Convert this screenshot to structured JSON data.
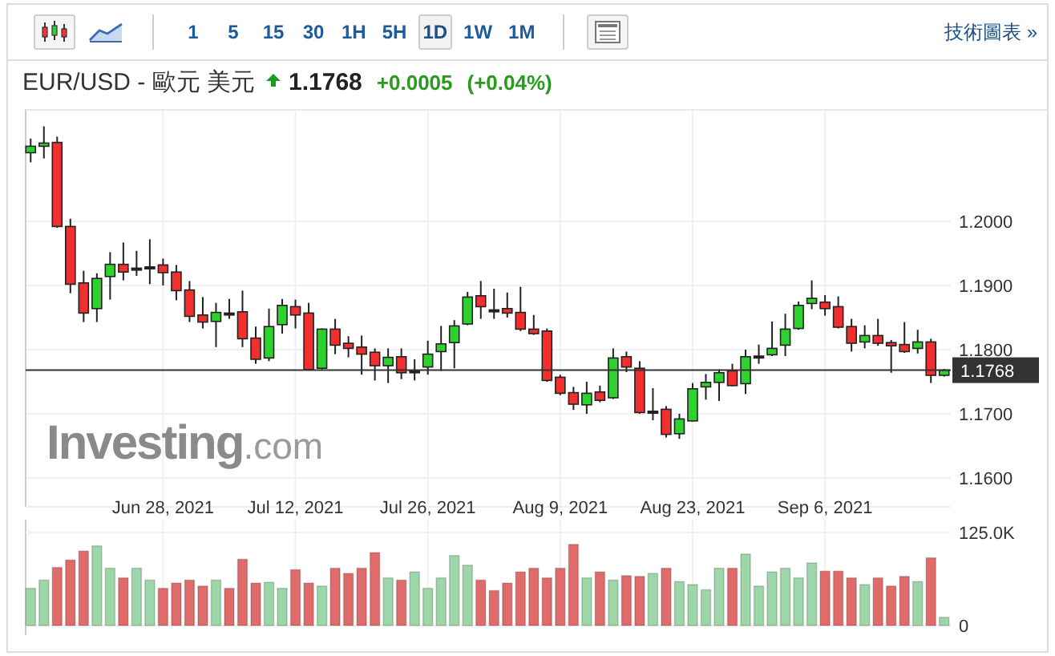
{
  "toolbar": {
    "chart_types": [
      {
        "kind": "candlestick",
        "selected": true
      },
      {
        "kind": "line",
        "selected": false
      }
    ],
    "intervals": [
      {
        "label": "1",
        "selected": false
      },
      {
        "label": "5",
        "selected": false
      },
      {
        "label": "15",
        "selected": false
      },
      {
        "label": "30",
        "selected": false
      },
      {
        "label": "1H",
        "selected": false
      },
      {
        "label": "5H",
        "selected": false
      },
      {
        "label": "1D",
        "selected": true
      },
      {
        "label": "1W",
        "selected": false
      },
      {
        "label": "1M",
        "selected": false
      }
    ],
    "link": "技術圖表 »"
  },
  "header": {
    "symbol": "EUR/USD - 歐元 美元",
    "price": "1.1768",
    "change": "+0.0005",
    "change_percent": "(+0.04%)"
  },
  "logo": {
    "name": "Investing",
    "domain": ".com"
  },
  "chart": {
    "chart_data": {
      "type": "candlestick",
      "grid": true,
      "categories": [
        null,
        null,
        null,
        null,
        null,
        null,
        null,
        null,
        null,
        null,
        "Jun 28, 2021",
        null,
        null,
        null,
        null,
        null,
        null,
        null,
        null,
        null,
        "Jul 12, 2021",
        null,
        null,
        null,
        null,
        null,
        null,
        null,
        null,
        null,
        "Jul 26, 2021",
        null,
        null,
        null,
        null,
        null,
        null,
        null,
        null,
        null,
        "Aug 9, 2021",
        null,
        null,
        null,
        null,
        null,
        null,
        null,
        null,
        null,
        "Aug 23, 2021",
        null,
        null,
        null,
        null,
        null,
        null,
        null,
        null,
        null,
        "Sep 6, 2021",
        null,
        null,
        null,
        null,
        null,
        null,
        null,
        null,
        null
      ],
      "ylim": [
        1.1555,
        1.2175
      ],
      "yticks": [
        {
          "value": 1.16,
          "label": "1.1600"
        },
        {
          "value": 1.17,
          "label": "1.1700"
        },
        {
          "value": 1.18,
          "label": "1.1800"
        },
        {
          "value": 1.19,
          "label": "1.1900"
        },
        {
          "value": 1.2,
          "label": "1.2000"
        }
      ],
      "ref_lines": [
        {
          "axis": "y",
          "value": 1.1768,
          "label": "1.1768"
        }
      ],
      "ohlc": [
        [
          1.2107,
          1.2129,
          1.2092,
          1.2117
        ],
        [
          1.2117,
          1.2148,
          1.2098,
          1.2122
        ],
        [
          1.2123,
          1.2132,
          1.199,
          1.1992
        ],
        [
          1.1992,
          1.2004,
          1.1888,
          1.1902
        ],
        [
          1.1904,
          1.1923,
          1.1843,
          1.1857
        ],
        [
          1.1864,
          1.1919,
          1.1843,
          1.1911
        ],
        [
          1.1914,
          1.1952,
          1.1878,
          1.1933
        ],
        [
          1.1933,
          1.1967,
          1.1908,
          1.1921
        ],
        [
          1.1927,
          1.1954,
          1.1915,
          1.1925
        ],
        [
          1.1929,
          1.1972,
          1.1902,
          1.1927
        ],
        [
          1.1932,
          1.1942,
          1.19,
          1.192
        ],
        [
          1.1921,
          1.1932,
          1.1877,
          1.1892
        ],
        [
          1.1893,
          1.1907,
          1.1843,
          1.1852
        ],
        [
          1.1854,
          1.1882,
          1.1833,
          1.1843
        ],
        [
          1.1844,
          1.1873,
          1.1804,
          1.1858
        ],
        [
          1.1857,
          1.1879,
          1.1848,
          1.1856
        ],
        [
          1.1859,
          1.1892,
          1.1804,
          1.1817
        ],
        [
          1.1818,
          1.1836,
          1.1778,
          1.1785
        ],
        [
          1.1787,
          1.1864,
          1.1782,
          1.1836
        ],
        [
          1.1839,
          1.1879,
          1.1825,
          1.1869
        ],
        [
          1.1867,
          1.1878,
          1.1833,
          1.1854
        ],
        [
          1.1857,
          1.1873,
          1.1769,
          1.1769
        ],
        [
          1.1771,
          1.1833,
          1.1769,
          1.1832
        ],
        [
          1.1832,
          1.1848,
          1.1793,
          1.1807
        ],
        [
          1.181,
          1.1821,
          1.1788,
          1.1802
        ],
        [
          1.1804,
          1.1822,
          1.1761,
          1.1793
        ],
        [
          1.1796,
          1.1802,
          1.1752,
          1.1775
        ],
        [
          1.1775,
          1.1802,
          1.1748,
          1.1788
        ],
        [
          1.1789,
          1.1802,
          1.1754,
          1.1764
        ],
        [
          1.1767,
          1.1785,
          1.1752,
          1.1765
        ],
        [
          1.1773,
          1.1814,
          1.1761,
          1.1793
        ],
        [
          1.1797,
          1.1837,
          1.1767,
          1.1809
        ],
        [
          1.1811,
          1.1846,
          1.1771,
          1.1837
        ],
        [
          1.184,
          1.189,
          1.1838,
          1.1882
        ],
        [
          1.1884,
          1.1907,
          1.1848,
          1.1867
        ],
        [
          1.1862,
          1.1895,
          1.1848,
          1.186
        ],
        [
          1.1864,
          1.1889,
          1.185,
          1.1857
        ],
        [
          1.1858,
          1.1898,
          1.1829,
          1.1832
        ],
        [
          1.1832,
          1.1854,
          1.1823,
          1.1825
        ],
        [
          1.1829,
          1.1833,
          1.175,
          1.1752
        ],
        [
          1.1757,
          1.1761,
          1.1729,
          1.1732
        ],
        [
          1.1733,
          1.1742,
          1.1706,
          1.1715
        ],
        [
          1.1714,
          1.175,
          1.17,
          1.1732
        ],
        [
          1.1734,
          1.1744,
          1.1718,
          1.1721
        ],
        [
          1.1725,
          1.1802,
          1.1723,
          1.1787
        ],
        [
          1.1789,
          1.1797,
          1.1765,
          1.1773
        ],
        [
          1.1771,
          1.1782,
          1.17,
          1.1702
        ],
        [
          1.1704,
          1.174,
          1.169,
          1.1702
        ],
        [
          1.1707,
          1.1712,
          1.1663,
          1.1668
        ],
        [
          1.1669,
          1.17,
          1.1661,
          1.1692
        ],
        [
          1.1689,
          1.1748,
          1.1688,
          1.1739
        ],
        [
          1.1742,
          1.1762,
          1.1722,
          1.1749
        ],
        [
          1.1749,
          1.1769,
          1.172,
          1.1764
        ],
        [
          1.1767,
          1.1778,
          1.1743,
          1.1744
        ],
        [
          1.1747,
          1.18,
          1.1731,
          1.1789
        ],
        [
          1.179,
          1.1808,
          1.1778,
          1.1788
        ],
        [
          1.1792,
          1.1844,
          1.179,
          1.1802
        ],
        [
          1.1807,
          1.1856,
          1.179,
          1.1832
        ],
        [
          1.1833,
          1.1875,
          1.1831,
          1.1869
        ],
        [
          1.1872,
          1.1908,
          1.1863,
          1.188
        ],
        [
          1.1874,
          1.1885,
          1.1853,
          1.1864
        ],
        [
          1.1867,
          1.1883,
          1.1833,
          1.1835
        ],
        [
          1.1836,
          1.1848,
          1.1797,
          1.181
        ],
        [
          1.1812,
          1.1838,
          1.1802,
          1.1822
        ],
        [
          1.1822,
          1.1848,
          1.1806,
          1.181
        ],
        [
          1.1811,
          1.1815,
          1.1764,
          1.1806
        ],
        [
          1.1808,
          1.1843,
          1.1795,
          1.1797
        ],
        [
          1.1802,
          1.1831,
          1.1794,
          1.1812
        ],
        [
          1.1812,
          1.1817,
          1.1748,
          1.176
        ],
        [
          1.176,
          1.177,
          1.1758,
          1.1768
        ]
      ]
    }
  },
  "volume": {
    "chart_data": {
      "type": "bar",
      "stacked": true,
      "grid": true,
      "ylim": [
        0,
        125
      ],
      "yticks": [
        {
          "value": 0,
          "label": "0"
        },
        {
          "value": 125,
          "label": "125.0K"
        }
      ],
      "series": [
        {
          "color": "#9dd6a8",
          "values": [
            50,
            61,
            null,
            null,
            null,
            107,
            77,
            null,
            77,
            61,
            null,
            null,
            null,
            null,
            61,
            null,
            null,
            null,
            58,
            50,
            null,
            null,
            53,
            null,
            null,
            null,
            null,
            64,
            null,
            72,
            50,
            64,
            94,
            81,
            null,
            null,
            null,
            null,
            null,
            null,
            null,
            null,
            64,
            null,
            61,
            null,
            null,
            70,
            null,
            59,
            55,
            48,
            77,
            null,
            96,
            53,
            72,
            77,
            64,
            84,
            null,
            null,
            null,
            55,
            null,
            null,
            null,
            59,
            null,
            11
          ]
        },
        {
          "color": "#e06b6b",
          "values": [
            null,
            null,
            78,
            88,
            100,
            null,
            null,
            64,
            null,
            null,
            50,
            57,
            61,
            53,
            null,
            50,
            89,
            57,
            null,
            null,
            75,
            57,
            null,
            77,
            70,
            77,
            98,
            null,
            61,
            null,
            null,
            null,
            null,
            null,
            61,
            47,
            57,
            72,
            77,
            64,
            77,
            109,
            null,
            72,
            null,
            67,
            66,
            null,
            77,
            null,
            null,
            null,
            null,
            77,
            null,
            null,
            null,
            null,
            null,
            null,
            73,
            73,
            64,
            null,
            64,
            53,
            66,
            null,
            91,
            null
          ]
        }
      ]
    }
  }
}
